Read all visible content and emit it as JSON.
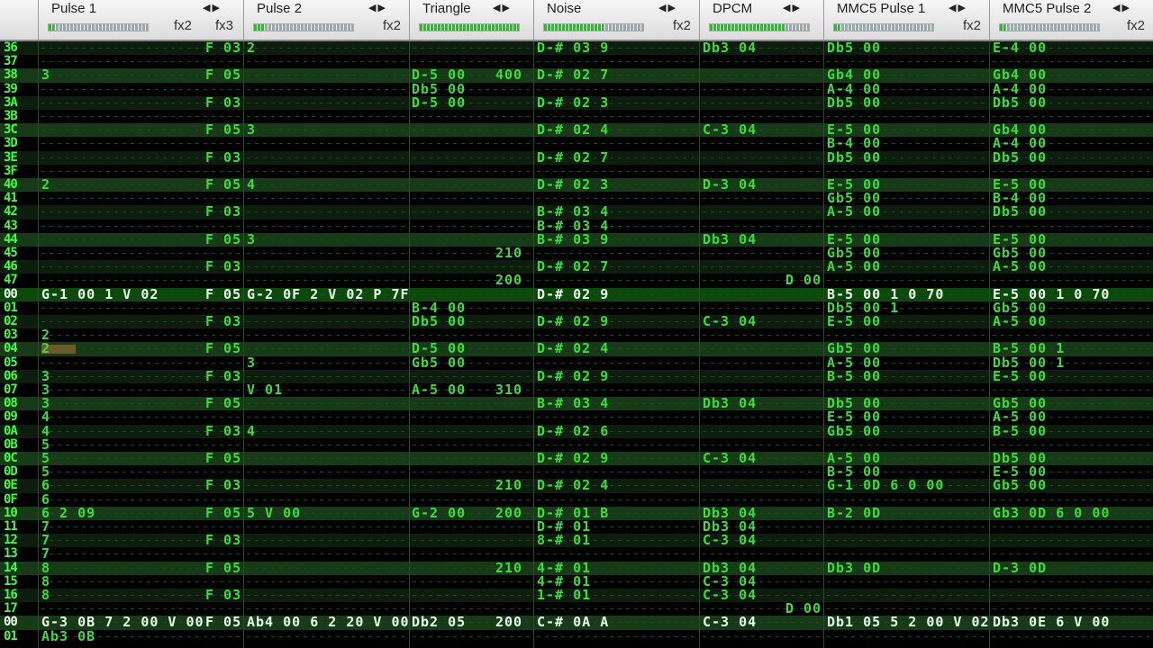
{
  "channels": [
    {
      "name": "Pulse 1",
      "fx": "fx2",
      "fx2": "fx3",
      "level": 0.05
    },
    {
      "name": "Pulse 2",
      "fx": "fx2",
      "fx2": "",
      "level": 0.1
    },
    {
      "name": "Triangle",
      "fx": "",
      "fx2": "",
      "level": 1.0
    },
    {
      "name": "Noise",
      "fx": "fx2",
      "fx2": "",
      "level": 0.6
    },
    {
      "name": "DPCM",
      "fx": "",
      "fx2": "",
      "level": 0.75
    },
    {
      "name": "MMC5 Pulse 1",
      "fx": "fx2",
      "fx2": "",
      "level": 0.05
    },
    {
      "name": "MMC5 Pulse 2",
      "fx": "fx2",
      "fx2": "",
      "level": 0.05
    }
  ],
  "rows": [
    {
      "n": "36",
      "c": {
        "p1i": "F 03",
        "p2": "2",
        "no": "D-# 03 9",
        "dp": "Db3 04",
        "m1": "Db5 00",
        "m2": "E-4 00"
      }
    },
    {
      "n": "37",
      "c": {}
    },
    {
      "n": "38",
      "c": {
        "p1": "3",
        "p1i": "F 05",
        "tr": "D-5 00",
        "tr2": "400",
        "no": "D-# 02 7",
        "m1": "Gb4 00",
        "m2": "Gb4 00"
      }
    },
    {
      "n": "39",
      "c": {
        "tr": "Db5 00",
        "m1": "A-4 00",
        "m2": "A-4 00"
      }
    },
    {
      "n": "3A",
      "c": {
        "p1i": "F 03",
        "tr": "D-5 00",
        "no": "D-# 02 3",
        "m1": "Db5 00",
        "m2": "Db5 00"
      }
    },
    {
      "n": "3B",
      "c": {}
    },
    {
      "n": "3C",
      "c": {
        "p1i": "F 05",
        "p2": "3",
        "no": "D-# 02 4",
        "dp": "C-3 04",
        "m1": "E-5 00",
        "m2": "Gb4 00"
      }
    },
    {
      "n": "3D",
      "c": {
        "m1": "B-4 00",
        "m2": "A-4 00"
      }
    },
    {
      "n": "3E",
      "c": {
        "p1i": "F 03",
        "no": "D-# 02 7",
        "m1": "Db5 00",
        "m2": "Db5 00"
      }
    },
    {
      "n": "3F",
      "c": {}
    },
    {
      "n": "40",
      "c": {
        "p1": "2",
        "p1i": "F 05",
        "p2": "4",
        "no": "D-# 02 3",
        "dp": "D-3 04",
        "m1": "E-5 00",
        "m2": "E-5 00"
      }
    },
    {
      "n": "41",
      "c": {
        "m1": "Gb5 00",
        "m2": "B-4 00"
      }
    },
    {
      "n": "42",
      "c": {
        "p1i": "F 03",
        "no": "B-# 03 4",
        "m1": "A-5 00",
        "m2": "Db5 00"
      }
    },
    {
      "n": "43",
      "c": {
        "no": "B-# 03 4"
      }
    },
    {
      "n": "44",
      "c": {
        "p1i": "F 05",
        "p2": "3",
        "no": "B-# 03 9",
        "dp": "Db3 04",
        "m1": "E-5 00",
        "m2": "E-5 00"
      }
    },
    {
      "n": "45",
      "c": {
        "tr2": "210",
        "m1": "Gb5 00",
        "m2": "Gb5 00"
      }
    },
    {
      "n": "46",
      "c": {
        "p1i": "F 03",
        "no": "D-# 02 7",
        "m1": "A-5 00",
        "m2": "A-5 00"
      }
    },
    {
      "n": "47",
      "c": {
        "tr2": "200",
        "dp2": "D 00"
      }
    },
    {
      "n": "00",
      "c": {
        "p1": "G-1 00 1 V 02",
        "p1i": "F 05",
        "p2": "G-2 0F 2 V 02 P 7F",
        "no": "D-# 02 9",
        "m1": "B-5 00 1 0 70",
        "m2": "E-5 00 1 0 70"
      }
    },
    {
      "n": "01",
      "c": {
        "tr": "B-4 00",
        "m1": "Db5 00 1",
        "m2": "Gb5 00"
      }
    },
    {
      "n": "02",
      "c": {
        "p1i": "F 03",
        "tr": "Db5 00",
        "no": "D-# 02 9",
        "dp": "C-3 04",
        "m1": "E-5 00",
        "m2": "A-5 00"
      }
    },
    {
      "n": "03",
      "c": {
        "p1": "2"
      }
    },
    {
      "n": "04",
      "c": {
        "p1": "2",
        "p1i": "F 05",
        "tr": "D-5 00",
        "no": "D-# 02 4",
        "m1": "Gb5 00",
        "m2": "B-5 00 1"
      }
    },
    {
      "n": "05",
      "c": {
        "p2": "3",
        "tr": "Gb5 00",
        "m1": "A-5 00",
        "m2": "Db5 00 1"
      }
    },
    {
      "n": "06",
      "c": {
        "p1": "3",
        "p1i": "F 03",
        "no": "D-# 02 9",
        "m1": "B-5 00",
        "m2": "E-5 00"
      }
    },
    {
      "n": "07",
      "c": {
        "p1": "3",
        "p2": "V 01",
        "tr": "A-5 00",
        "tr2": "310"
      }
    },
    {
      "n": "08",
      "c": {
        "p1": "3",
        "p1i": "F 05",
        "no": "B-# 03 4",
        "dp": "Db3 04",
        "m1": "Db5 00",
        "m2": "Gb5 00"
      }
    },
    {
      "n": "09",
      "c": {
        "p1": "4",
        "m1": "E-5 00",
        "m2": "A-5 00"
      }
    },
    {
      "n": "0A",
      "c": {
        "p1": "4",
        "p1i": "F 03",
        "p2": "4",
        "no": "D-# 02 6",
        "m1": "Gb5 00",
        "m2": "B-5 00"
      }
    },
    {
      "n": "0B",
      "c": {
        "p1": "5"
      }
    },
    {
      "n": "0C",
      "c": {
        "p1": "5",
        "p1i": "F 05",
        "no": "D-# 02 9",
        "dp": "C-3 04",
        "m1": "A-5 00",
        "m2": "Db5 00"
      }
    },
    {
      "n": "0D",
      "c": {
        "p1": "5",
        "m1": "B-5 00",
        "m2": "E-5 00"
      }
    },
    {
      "n": "0E",
      "c": {
        "p1": "6",
        "p1i": "F 03",
        "tr2": "210",
        "no": "D-# 02 4",
        "m1": "G-1 0D 6 0 00",
        "m2": "Gb5 00"
      }
    },
    {
      "n": "0F",
      "c": {
        "p1": "6"
      }
    },
    {
      "n": "10",
      "c": {
        "p1": "6 2 09",
        "p1i": "F 05",
        "p2": "5 V 00",
        "tr": "G-2 00",
        "tr2": "200",
        "no": "D-# 01 B",
        "dp": "Db3 04",
        "m1": "B-2 0D",
        "m2": "Gb3 0D 6 0 00"
      }
    },
    {
      "n": "11",
      "c": {
        "p1": "7",
        "no": "D-# 01",
        "dp": "Db3 04"
      }
    },
    {
      "n": "12",
      "c": {
        "p1": "7",
        "p1i": "F 03",
        "no": "8-# 01",
        "dp": "C-3 04"
      }
    },
    {
      "n": "13",
      "c": {
        "p1": "7"
      }
    },
    {
      "n": "14",
      "c": {
        "p1": "8",
        "p1i": "F 05",
        "tr2": "210",
        "no": "4-# 01",
        "dp": "Db3 04",
        "m1": "Db3 0D",
        "m2": "D-3 0D"
      }
    },
    {
      "n": "15",
      "c": {
        "p1": "8",
        "no": "4-# 01",
        "dp": "C-3 04"
      }
    },
    {
      "n": "16",
      "c": {
        "p1": "8",
        "p1i": "F 03",
        "no": "1-# 01",
        "dp": "C-3 04"
      }
    },
    {
      "n": "17",
      "c": {
        "dp2": "D 00"
      }
    },
    {
      "n": "00",
      "c": {
        "p1": "G-3 0B 7 2 00 V 00",
        "p1i": "F 05",
        "p2": "Ab4 00 6 2 20 V 00",
        "tr": "Db2 05",
        "tr2": "200",
        "no": "C-# 0A A",
        "dp": "C-3 04",
        "m1": "Db1 05 5 2 00 V 02",
        "m2": "Db3 0E 6 V 00"
      }
    },
    {
      "n": "01",
      "c": {
        "p1": "Ab3 0B"
      }
    }
  ]
}
